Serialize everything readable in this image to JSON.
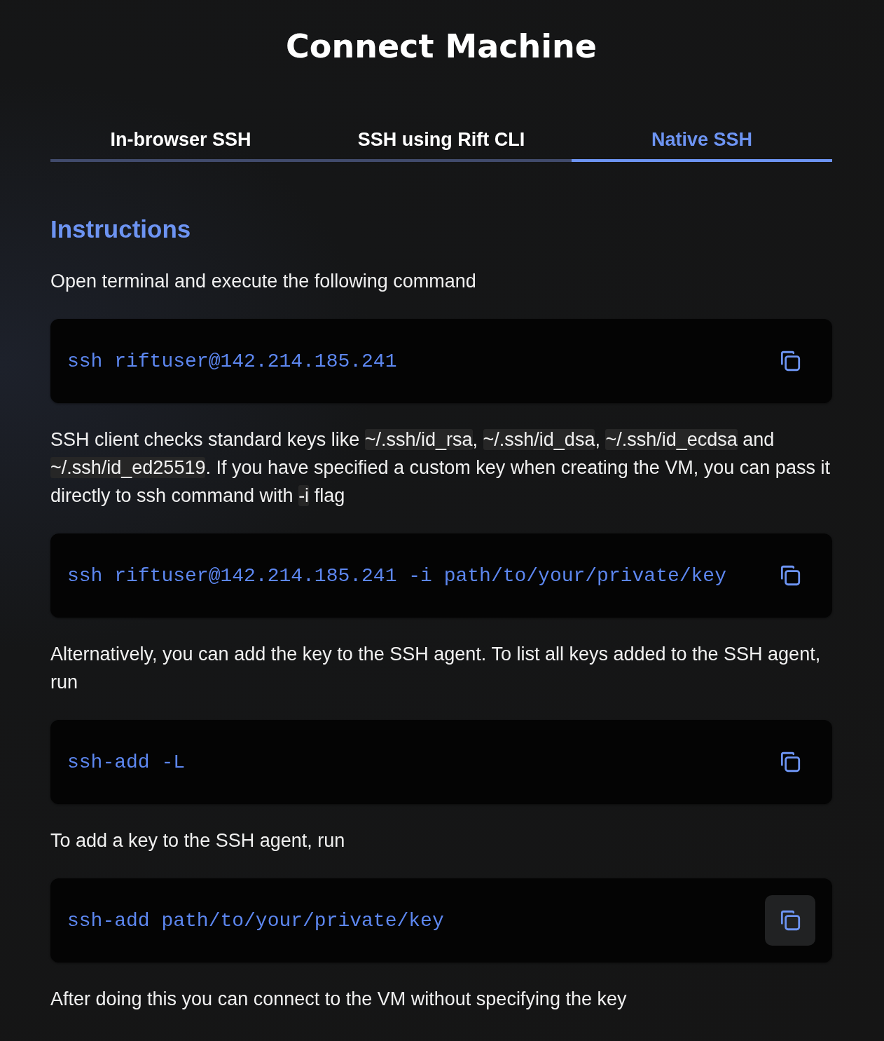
{
  "title": "Connect Machine",
  "tabs": [
    {
      "label": "In-browser SSH",
      "selected": false
    },
    {
      "label": "SSH using Rift CLI",
      "selected": false
    },
    {
      "label": "Native SSH",
      "selected": true
    }
  ],
  "heading": "Instructions",
  "content": [
    {
      "kind": "paragraph",
      "parts": [
        {
          "kind": "text",
          "text": "Open terminal and execute the following command"
        }
      ]
    },
    {
      "kind": "code",
      "command": "ssh riftuser@142.214.185.241",
      "hovered": false
    },
    {
      "kind": "paragraph",
      "parts": [
        {
          "kind": "text",
          "text": "SSH client checks standard keys like "
        },
        {
          "kind": "code",
          "text": "~/.ssh/id_rsa"
        },
        {
          "kind": "text",
          "text": ", "
        },
        {
          "kind": "code",
          "text": "~/.ssh/id_dsa"
        },
        {
          "kind": "text",
          "text": ", "
        },
        {
          "kind": "code",
          "text": "~/.ssh/id_ecdsa"
        },
        {
          "kind": "text",
          "text": " and "
        },
        {
          "kind": "code",
          "text": "~/.ssh/id_ed25519"
        },
        {
          "kind": "text",
          "text": ". If you have specified a custom key when creating the VM, you can pass it directly to ssh command with "
        },
        {
          "kind": "code",
          "text": "-i"
        },
        {
          "kind": "text",
          "text": " flag"
        }
      ]
    },
    {
      "kind": "code",
      "command": "ssh riftuser@142.214.185.241 -i path/to/your/private/key",
      "hovered": false
    },
    {
      "kind": "paragraph",
      "parts": [
        {
          "kind": "text",
          "text": "Alternatively, you can add the key to the SSH agent. To list all keys added to the SSH agent, run"
        }
      ]
    },
    {
      "kind": "code",
      "command": "ssh-add -L",
      "hovered": false
    },
    {
      "kind": "paragraph",
      "parts": [
        {
          "kind": "text",
          "text": "To add a key to the SSH agent, run"
        }
      ]
    },
    {
      "kind": "code",
      "command": "ssh-add path/to/your/private/key",
      "hovered": true
    },
    {
      "kind": "paragraph",
      "parts": [
        {
          "kind": "text",
          "text": "After doing this you can connect to the VM without specifying the key"
        }
      ]
    }
  ]
}
